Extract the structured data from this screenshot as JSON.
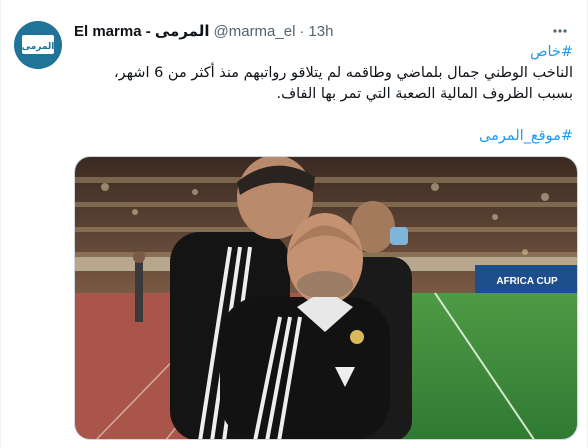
{
  "author": {
    "display_name": "El marma - المرمى",
    "handle": "@marma_el",
    "separator": "·",
    "time": "13h",
    "avatar_text": "المرمى"
  },
  "tweet": {
    "hashtag_top": "#خاص",
    "text_line1": "الناخب الوطني جمال بلماضي وطاقمه لم يتلاقو رواتبهم منذ أكثر من 6 اشهر،",
    "text_line2": "بسبب الظروف المالية الصعبة التي تمر بها الفاف.",
    "hashtag_bottom": "#موقع_المرمى"
  },
  "media": {
    "ad_board_text": "AFRICA CUP",
    "colors": {
      "pitch": "#3f8a3c",
      "track": "#b3584a",
      "jersey": "#121212",
      "stands": "#5c4030"
    }
  },
  "icons": {
    "more": "more-dots-icon"
  }
}
